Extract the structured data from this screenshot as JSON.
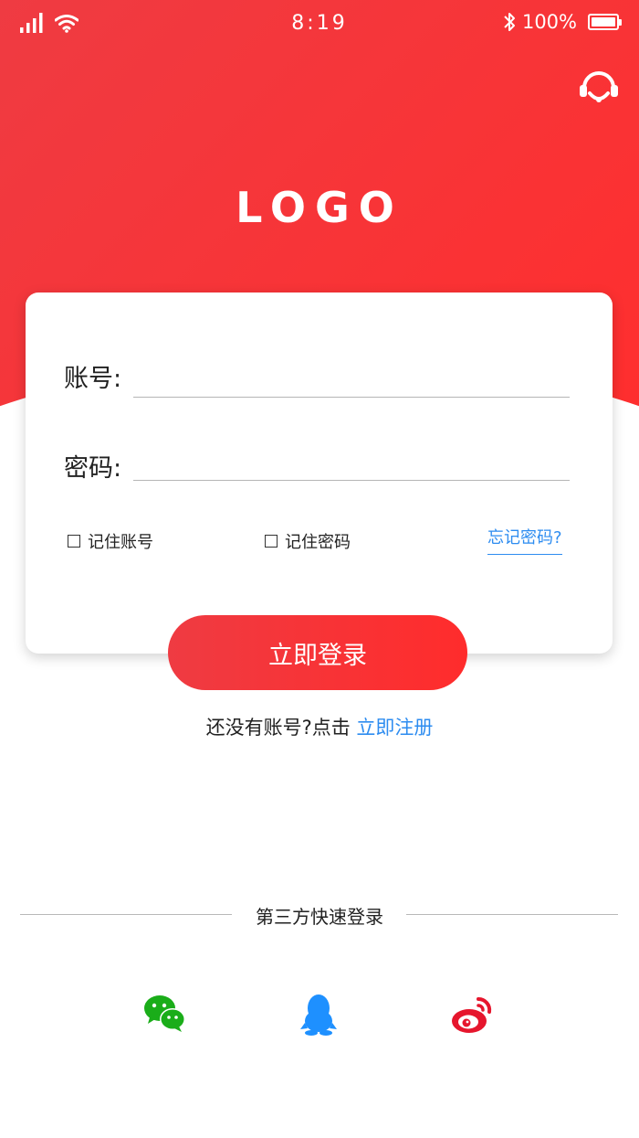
{
  "status_bar": {
    "time": "8:19",
    "battery": "100%"
  },
  "header": {
    "logo": "LOGO",
    "support_icon": "headset-icon"
  },
  "form": {
    "account_label": "账号:",
    "password_label": "密码:",
    "remember_account": "记住账号",
    "remember_password": "记住密码",
    "forgot_password": "忘记密码?",
    "login_button": "立即登录"
  },
  "register": {
    "prompt": "还没有账号?点击 ",
    "link": "立即注册"
  },
  "third_party": {
    "title": "第三方快速登录",
    "providers": [
      {
        "icon": "wechat-icon",
        "color": "#1aad19"
      },
      {
        "icon": "qq-icon",
        "color": "#1e90ff"
      },
      {
        "icon": "weibo-icon",
        "color": "#e6162d"
      }
    ]
  },
  "colors": {
    "primary": "#ef3b42",
    "link": "#2d8cf0"
  }
}
